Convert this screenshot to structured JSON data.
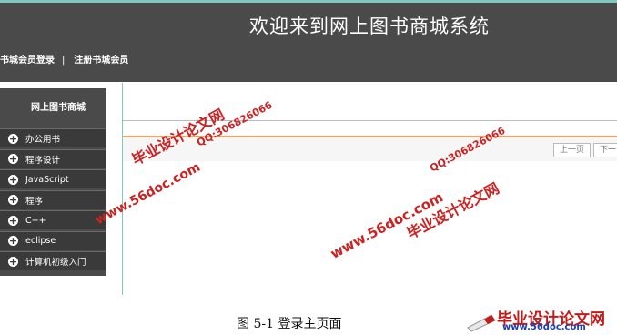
{
  "header": {
    "title": "欢迎来到网上图书商城系统",
    "member_login": "书城会员登录",
    "separator": "|",
    "register": "注册书城会员"
  },
  "sidebar": {
    "title": "网上图书商城",
    "items": [
      {
        "label": "办公用书"
      },
      {
        "label": "程序设计"
      },
      {
        "label": "JavaScript"
      },
      {
        "label": "程序"
      },
      {
        "label": "C++"
      },
      {
        "label": "eclipse"
      },
      {
        "label": "计算机初级入门"
      }
    ]
  },
  "pager": {
    "prev": "上一页",
    "next": "下一"
  },
  "watermarks": {
    "site": "www.56doc.com",
    "brand": "毕业设计论文网",
    "qq": "QQ:306826066"
  },
  "caption": "图 5-1 登录主页面",
  "corner_logo": {
    "main": "毕业设计论文网",
    "url": "www.56doc.com"
  },
  "colors": {
    "header_bg": "#4a4a4a",
    "accent_teal": "#7fc8c0",
    "orange_line": "#f0a060",
    "watermark_red": "#cc2222"
  }
}
